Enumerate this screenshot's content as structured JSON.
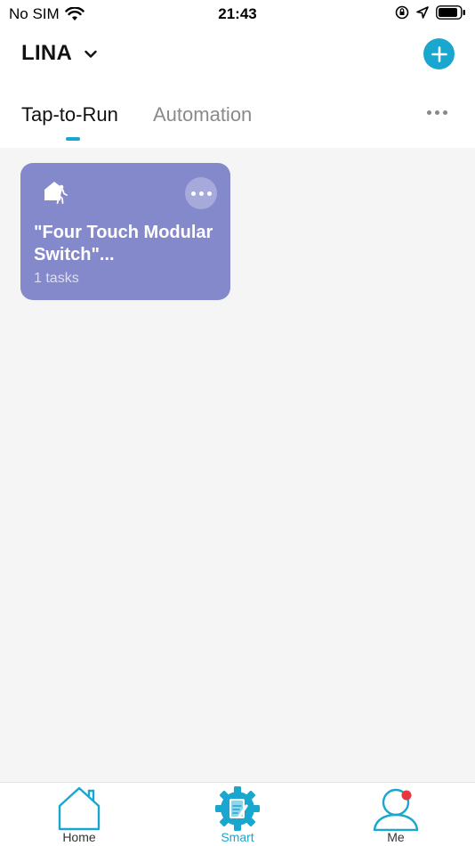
{
  "status_bar": {
    "carrier": "No SIM",
    "time": "21:43",
    "icons": [
      "wifi-icon",
      "orientation-lock-icon",
      "location-arrow-icon",
      "battery-icon"
    ]
  },
  "header": {
    "home_name": "LINA",
    "add_icon": "plus-icon"
  },
  "tabs": [
    {
      "label": "Tap-to-Run",
      "active": true
    },
    {
      "label": "Automation",
      "active": false
    }
  ],
  "scenes": [
    {
      "title": "\"Four Touch Modular Switch\"...",
      "subtitle": "1 tasks",
      "icon": "home-person-icon",
      "color": "#8489cc"
    }
  ],
  "bottom_nav": {
    "items": [
      {
        "label": "Home",
        "icon": "home-icon",
        "active": false
      },
      {
        "label": "Smart",
        "icon": "smart-gear-icon",
        "active": true
      },
      {
        "label": "Me",
        "icon": "user-profile-icon",
        "active": false
      }
    ]
  },
  "colors": {
    "accent": "#1aa7cf",
    "scene_card": "#8489cc",
    "notification_dot": "#e8383d"
  }
}
